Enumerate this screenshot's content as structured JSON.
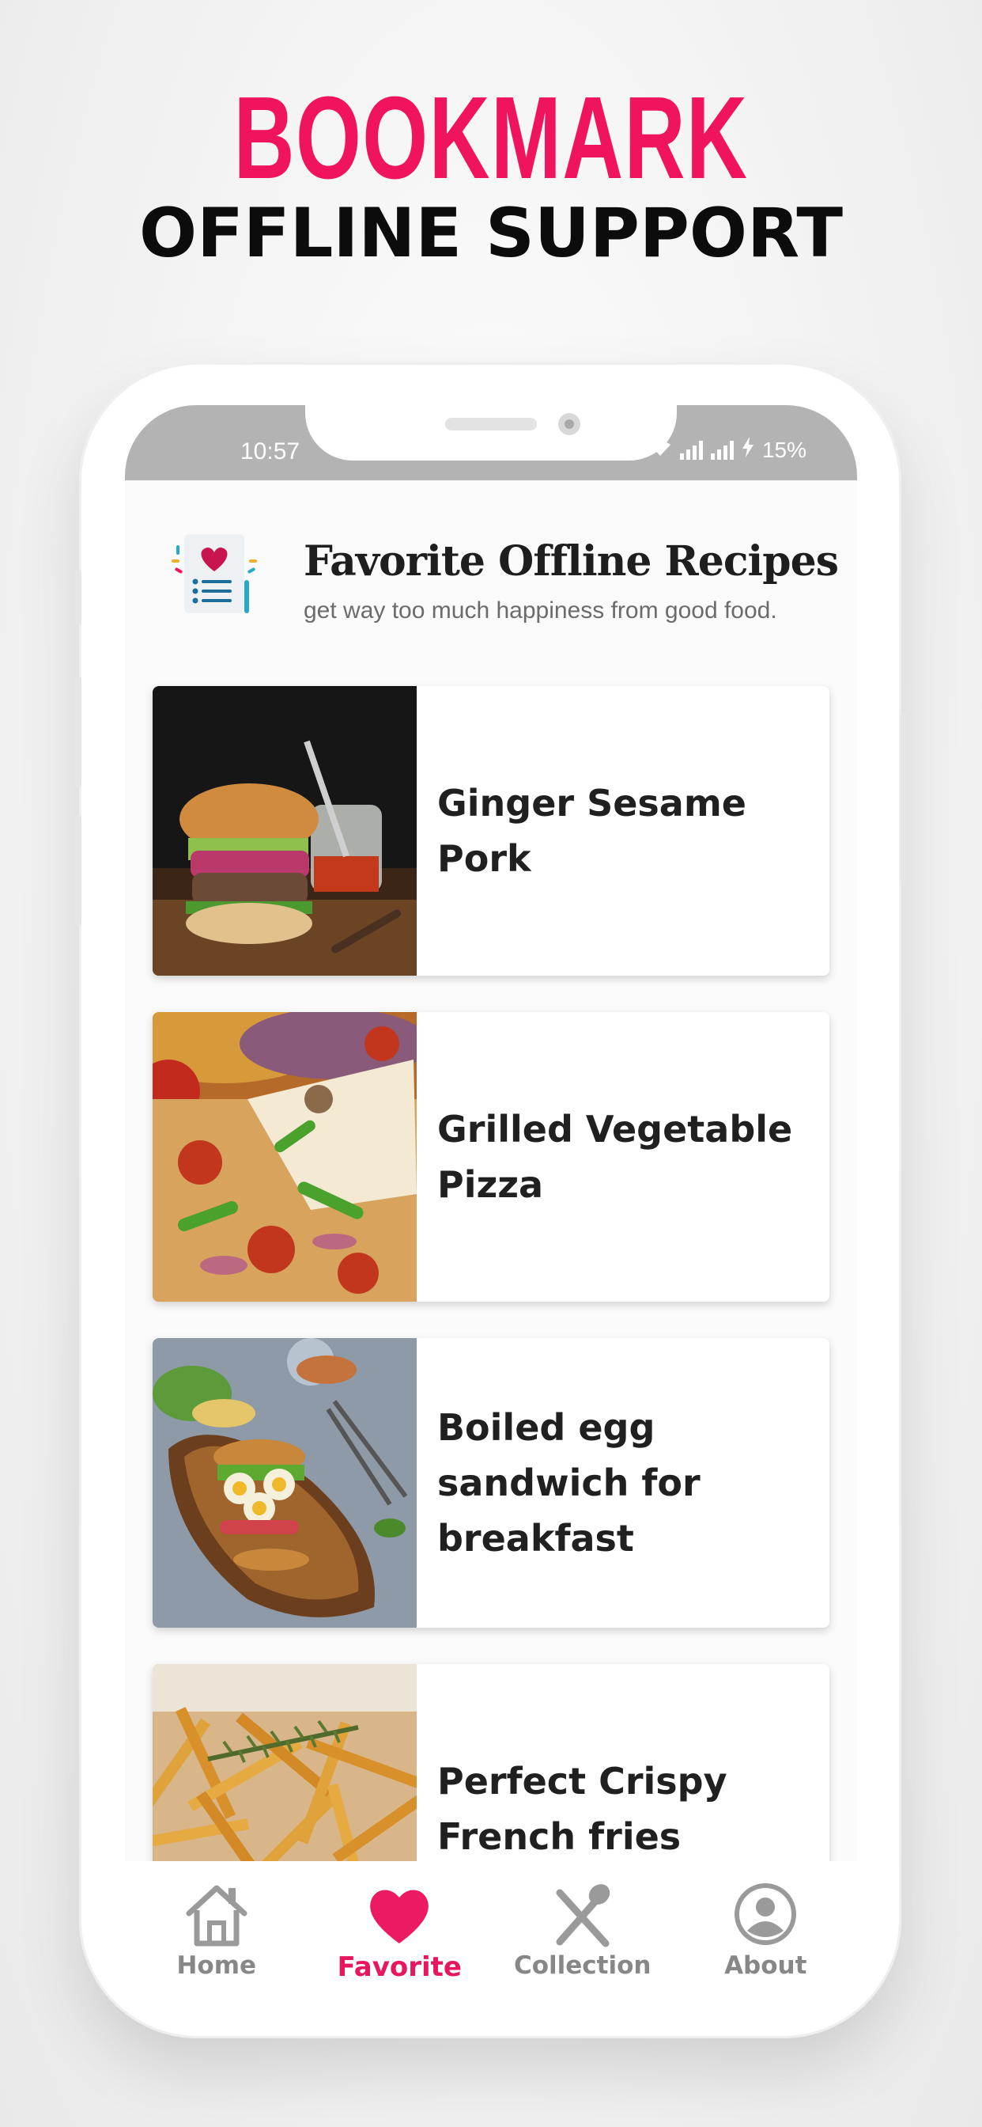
{
  "promo": {
    "title": "BOOKMARK",
    "subtitle": "OFFLINE SUPPORT"
  },
  "status_bar": {
    "time": "10:57",
    "battery": "15%"
  },
  "app_header": {
    "title": "Favorite Offline Recipes",
    "subtitle": "get way too much happiness from good food."
  },
  "recipes": [
    {
      "title": "Ginger Sesame Pork",
      "image": "burger-photo"
    },
    {
      "title": "Grilled Vegetable Pizza",
      "image": "pizza-photo"
    },
    {
      "title": "Boiled egg sandwich for breakfast",
      "image": "sandwich-photo"
    },
    {
      "title": "Perfect Crispy French fries",
      "image": "fries-photo"
    }
  ],
  "bottom_nav": {
    "items": [
      {
        "label": "Home",
        "icon": "home-icon",
        "active": false
      },
      {
        "label": "Favorite",
        "icon": "heart-icon",
        "active": true
      },
      {
        "label": "Collection",
        "icon": "spoon-knife-icon",
        "active": false
      },
      {
        "label": "About",
        "icon": "user-circle-icon",
        "active": false
      }
    ]
  },
  "colors": {
    "accent": "#f0145e",
    "nav_inactive": "#878787",
    "status_bar": "#b3b3b3"
  }
}
